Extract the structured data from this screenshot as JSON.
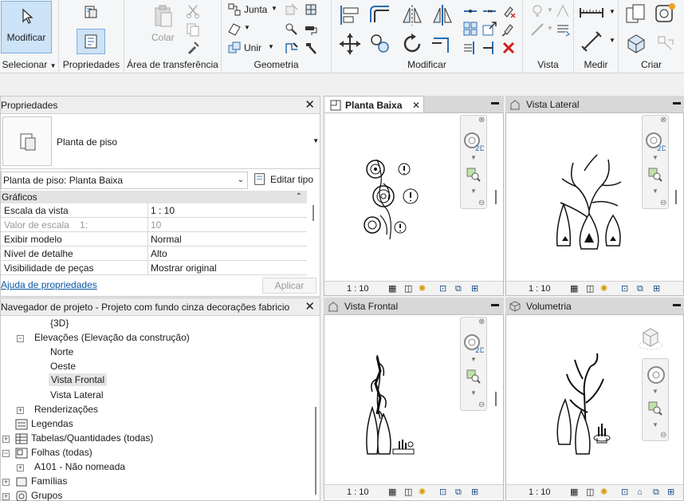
{
  "ribbon": {
    "modify_label": "Modificar",
    "select_label": "Selecionar",
    "properties_label": "Propriedades",
    "clipboard_label": "Área de transferência",
    "paste_label": "Colar",
    "geometry_label": "Geometria",
    "join_label": "Junta",
    "unite_label": "Unir",
    "modify_group_label": "Modificar",
    "view_label": "Vista",
    "measure_label": "Medir",
    "create_label": "Criar"
  },
  "properties": {
    "title": "Propriedades",
    "type_name": "Planta de piso",
    "instance_selector": "Planta de piso: Planta Baixa",
    "edit_type": "Editar tipo",
    "section": "Gráficos",
    "rows": [
      {
        "key": "Escala da vista",
        "value": "1 : 10"
      },
      {
        "key": "Valor de escala    1:",
        "value": "10"
      },
      {
        "key": "Exibir modelo",
        "value": "Normal"
      },
      {
        "key": "Nível de detalhe",
        "value": "Alto"
      },
      {
        "key": "Visibilidade de peças",
        "value": "Mostrar original"
      }
    ],
    "help_link": "Ajuda de propriedades",
    "apply": "Aplicar"
  },
  "browser": {
    "title": "Navegador de projeto - Projeto com fundo cinza decorações fabricio",
    "items": [
      {
        "label": "{3D}"
      },
      {
        "label": "Elevações (Elevação da construção)"
      },
      {
        "label": "Norte"
      },
      {
        "label": "Oeste"
      },
      {
        "label": "Vista Frontal"
      },
      {
        "label": "Vista Lateral"
      },
      {
        "label": "Renderizações"
      },
      {
        "label": "Legendas"
      },
      {
        "label": "Tabelas/Quantidades (todas)"
      },
      {
        "label": "Folhas (todas)"
      },
      {
        "label": "A101 - Não nomeada"
      },
      {
        "label": "Famílias"
      },
      {
        "label": "Grupos"
      }
    ]
  },
  "views": [
    {
      "title": "Planta Baixa",
      "scale": "1 : 10"
    },
    {
      "title": "Vista Lateral",
      "scale": "1 : 10"
    },
    {
      "title": "Vista Frontal",
      "scale": "1 : 10"
    },
    {
      "title": "Volumetria",
      "scale": "1 : 10"
    }
  ],
  "colors": {
    "accent": "#0b5cad",
    "selected_bg": "#cce4f7",
    "link": "#0a57a4"
  }
}
